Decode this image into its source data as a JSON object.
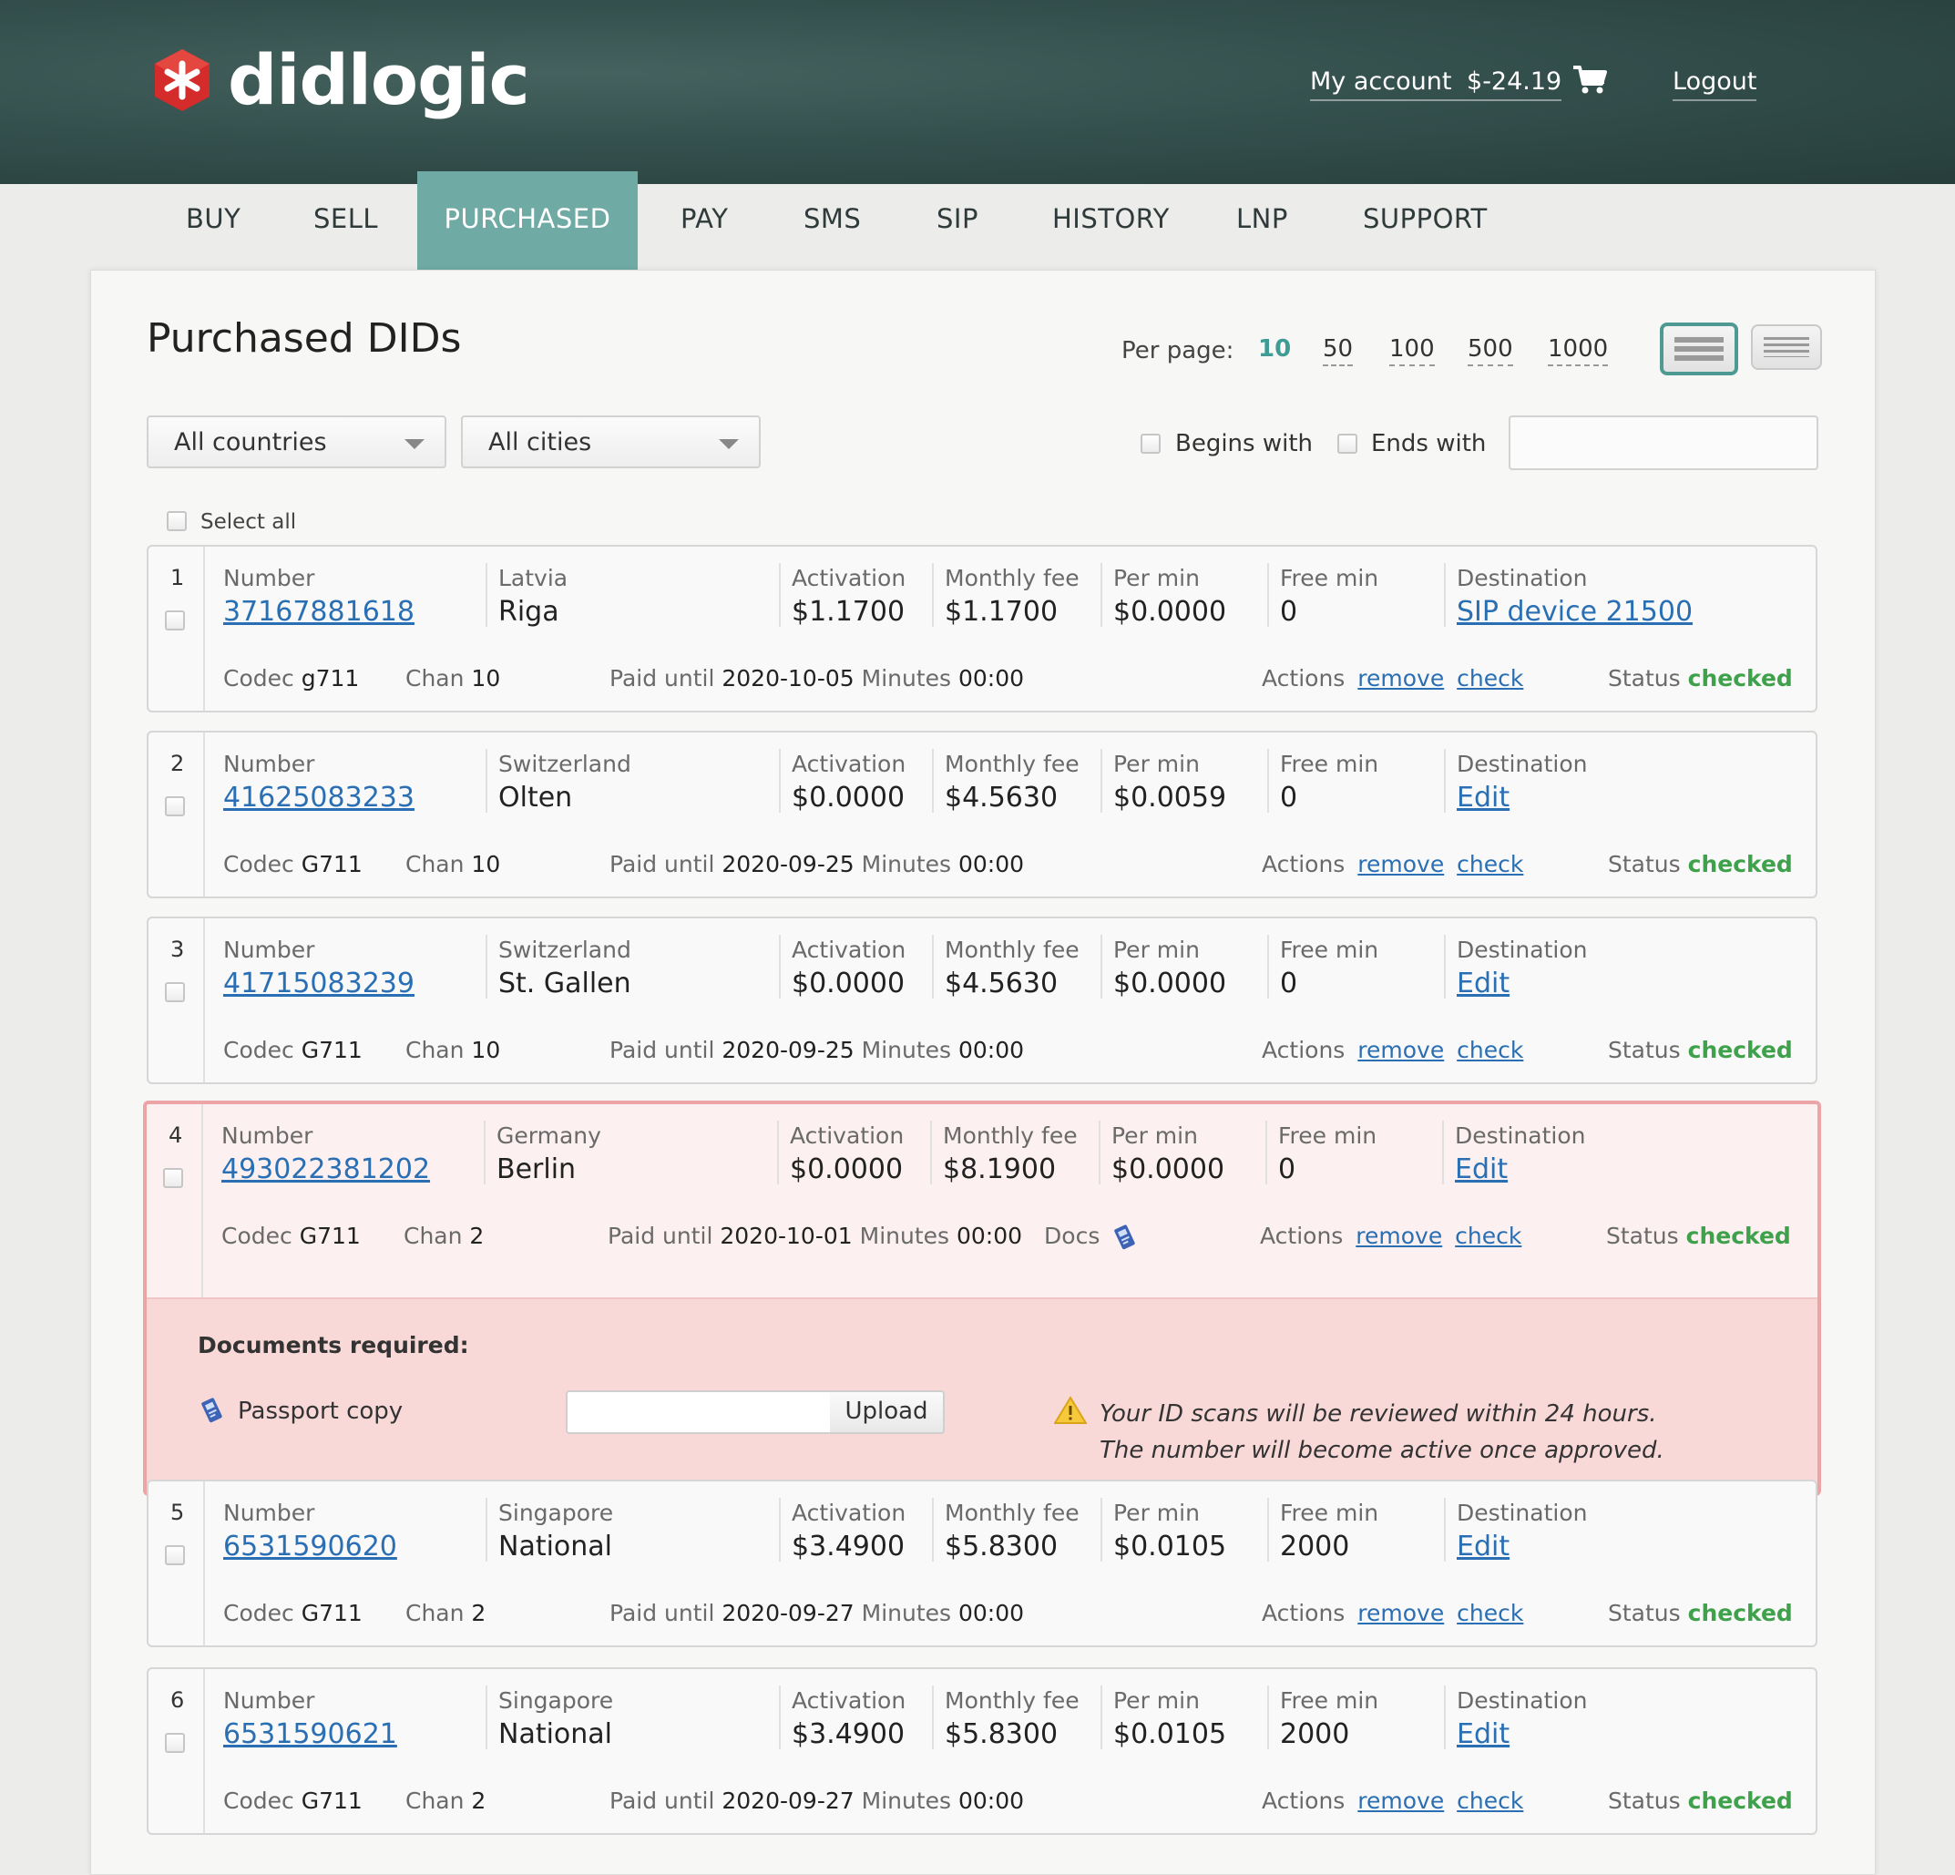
{
  "brand": {
    "name": "didlogic",
    "color": "#d42b2b"
  },
  "header": {
    "account_label": "My account",
    "balance": "$-24.19",
    "logout": "Logout",
    "cart_icon": "cart-icon"
  },
  "nav": [
    "BUY",
    "SELL",
    "PURCHASED",
    "PAY",
    "SMS",
    "SIP",
    "HISTORY",
    "LNP",
    "SUPPORT"
  ],
  "nav_active": "PURCHASED",
  "page": {
    "title": "Purchased DIDs",
    "per_page_label": "Per page:",
    "per_page": [
      "10",
      "50",
      "100",
      "500",
      "1000"
    ],
    "per_page_selected": "10"
  },
  "filters": {
    "country": "All countries",
    "city": "All cities",
    "begins_with": "Begins with",
    "ends_with": "Ends with",
    "search_value": "",
    "select_all": "Select all"
  },
  "labels": {
    "number": "Number",
    "activation": "Activation",
    "monthly_fee": "Monthly fee",
    "per_min": "Per min",
    "free_min": "Free min",
    "destination": "Destination",
    "codec": "Codec",
    "chan": "Chan",
    "paid_until": "Paid until",
    "minutes": "Minutes",
    "docs": "Docs",
    "actions": "Actions",
    "remove": "remove",
    "check": "check",
    "status": "Status"
  },
  "rows": [
    {
      "idx": "1",
      "number": "37167881618",
      "country": "Latvia",
      "city": "Riga",
      "activation": "$1.1700",
      "monthly": "$1.1700",
      "per_min": "$0.0000",
      "free_min": "0",
      "destination": "SIP device 21500",
      "codec": "g711",
      "chan": "10",
      "paid_until": "2020-10-05",
      "minutes": "00:00",
      "status": "checked"
    },
    {
      "idx": "2",
      "number": "41625083233",
      "country": "Switzerland",
      "city": "Olten",
      "activation": "$0.0000",
      "monthly": "$4.5630",
      "per_min": "$0.0059",
      "free_min": "0",
      "destination": "Edit",
      "codec": "G711",
      "chan": "10",
      "paid_until": "2020-09-25",
      "minutes": "00:00",
      "status": "checked"
    },
    {
      "idx": "3",
      "number": "41715083239",
      "country": "Switzerland",
      "city": "St. Gallen",
      "activation": "$0.0000",
      "monthly": "$4.5630",
      "per_min": "$0.0000",
      "free_min": "0",
      "destination": "Edit",
      "codec": "G711",
      "chan": "10",
      "paid_until": "2020-09-25",
      "minutes": "00:00",
      "status": "checked"
    },
    {
      "idx": "4",
      "number": "493022381202",
      "country": "Germany",
      "city": "Berlin",
      "activation": "$0.0000",
      "monthly": "$8.1900",
      "per_min": "$0.0000",
      "free_min": "0",
      "destination": "Edit",
      "codec": "G711",
      "chan": "2",
      "paid_until": "2020-10-01",
      "minutes": "00:00",
      "status": "checked"
    },
    {
      "idx": "5",
      "number": "6531590620",
      "country": "Singapore",
      "city": "National",
      "activation": "$3.4900",
      "monthly": "$5.8300",
      "per_min": "$0.0105",
      "free_min": "2000",
      "destination": "Edit",
      "codec": "G711",
      "chan": "2",
      "paid_until": "2020-09-27",
      "minutes": "00:00",
      "status": "checked"
    },
    {
      "idx": "6",
      "number": "6531590621",
      "country": "Singapore",
      "city": "National",
      "activation": "$3.4900",
      "monthly": "$5.8300",
      "per_min": "$0.0105",
      "free_min": "2000",
      "destination": "Edit",
      "codec": "G711",
      "chan": "2",
      "paid_until": "2020-09-27",
      "minutes": "00:00",
      "status": "checked"
    }
  ],
  "documents": {
    "heading": "Documents required:",
    "item": "Passport copy",
    "upload": "Upload",
    "message_line1": "Your ID scans will be reviewed within 24 hours.",
    "message_line2": "The number will become active once approved."
  },
  "colors": {
    "accent": "#6faaa4",
    "link": "#2a6fb3",
    "status_ok": "#3fa14b",
    "alert_bg": "#f8d9d8"
  }
}
